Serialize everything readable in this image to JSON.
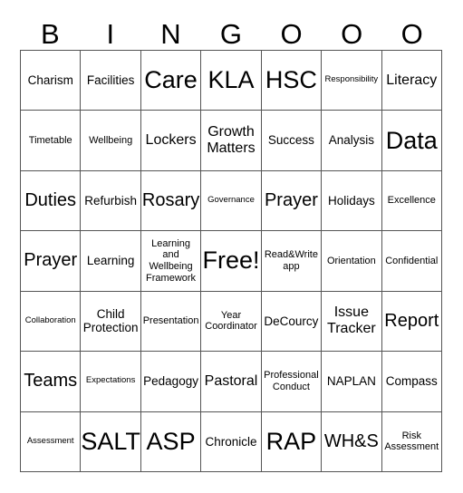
{
  "header": [
    "B",
    "I",
    "N",
    "G",
    "O",
    "O",
    "O"
  ],
  "cells": [
    [
      {
        "t": "Charism",
        "s": "md"
      },
      {
        "t": "Facilities",
        "s": "md"
      },
      {
        "t": "Care",
        "s": "xxl"
      },
      {
        "t": "KLA",
        "s": "xxl"
      },
      {
        "t": "HSC",
        "s": "xxl"
      },
      {
        "t": "Responsibility",
        "s": "xs"
      },
      {
        "t": "Literacy",
        "s": "lg"
      }
    ],
    [
      {
        "t": "Timetable",
        "s": "sm"
      },
      {
        "t": "Wellbeing",
        "s": "sm"
      },
      {
        "t": "Lockers",
        "s": "lg"
      },
      {
        "t": "Growth Matters",
        "s": "lg"
      },
      {
        "t": "Success",
        "s": "md"
      },
      {
        "t": "Analysis",
        "s": "md"
      },
      {
        "t": "Data",
        "s": "xxl"
      }
    ],
    [
      {
        "t": "Duties",
        "s": "xl"
      },
      {
        "t": "Refurbish",
        "s": "md"
      },
      {
        "t": "Rosary",
        "s": "xl"
      },
      {
        "t": "Governance",
        "s": "xs"
      },
      {
        "t": "Prayer",
        "s": "xl"
      },
      {
        "t": "Holidays",
        "s": "md"
      },
      {
        "t": "Excellence",
        "s": "sm"
      }
    ],
    [
      {
        "t": "Prayer",
        "s": "xl"
      },
      {
        "t": "Learning",
        "s": "md"
      },
      {
        "t": "Learning and Wellbeing Framework",
        "s": "sm"
      },
      {
        "t": "Free!",
        "s": "xxl"
      },
      {
        "t": "Read&Write app",
        "s": "sm"
      },
      {
        "t": "Orientation",
        "s": "sm"
      },
      {
        "t": "Confidential",
        "s": "sm"
      }
    ],
    [
      {
        "t": "Collaboration",
        "s": "xs"
      },
      {
        "t": "Child Protection",
        "s": "md"
      },
      {
        "t": "Presentation",
        "s": "sm"
      },
      {
        "t": "Year Coordinator",
        "s": "sm"
      },
      {
        "t": "DeCourcy",
        "s": "md"
      },
      {
        "t": "Issue Tracker",
        "s": "lg"
      },
      {
        "t": "Report",
        "s": "xl"
      }
    ],
    [
      {
        "t": "Teams",
        "s": "xl"
      },
      {
        "t": "Expectations",
        "s": "xs"
      },
      {
        "t": "Pedagogy",
        "s": "md"
      },
      {
        "t": "Pastoral",
        "s": "lg"
      },
      {
        "t": "Professional Conduct",
        "s": "sm"
      },
      {
        "t": "NAPLAN",
        "s": "md"
      },
      {
        "t": "Compass",
        "s": "md"
      }
    ],
    [
      {
        "t": "Assessment",
        "s": "xs"
      },
      {
        "t": "SALT",
        "s": "xxl"
      },
      {
        "t": "ASP",
        "s": "xxl"
      },
      {
        "t": "Chronicle",
        "s": "md"
      },
      {
        "t": "RAP",
        "s": "xxl"
      },
      {
        "t": "WH&S",
        "s": "xl"
      },
      {
        "t": "Risk Assessment",
        "s": "sm"
      }
    ]
  ]
}
